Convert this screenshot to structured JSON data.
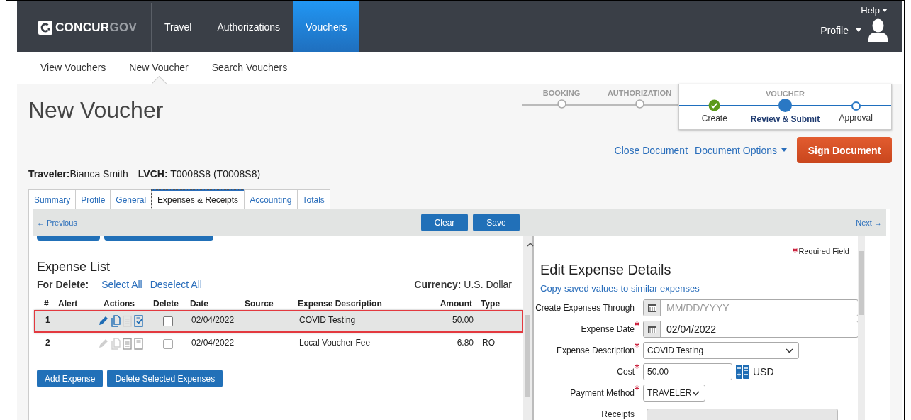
{
  "nav": {
    "logo": {
      "main": "CONCUR",
      "suffix": "GOV"
    },
    "tabs": [
      {
        "label": "Travel",
        "selected": false
      },
      {
        "label": "Authorizations",
        "selected": false
      },
      {
        "label": "Vouchers",
        "selected": true
      }
    ],
    "help": "Help",
    "profile": "Profile"
  },
  "subnav": [
    {
      "label": "View Vouchers",
      "selected": false
    },
    {
      "label": "New Voucher",
      "selected": true
    },
    {
      "label": "Search Vouchers",
      "selected": false
    }
  ],
  "page_title": "New Voucher",
  "progress": [
    {
      "label": "BOOKING",
      "selected": false
    },
    {
      "label": "AUTHORIZATION",
      "selected": false
    },
    {
      "label": "VOUCHER",
      "selected": true,
      "steps": [
        {
          "label": "Create",
          "completed": true,
          "selected": false
        },
        {
          "label": "Review & Submit",
          "completed": false,
          "selected": true
        },
        {
          "label": "Approval",
          "completed": false,
          "selected": false
        }
      ]
    }
  ],
  "document_actions": {
    "links": [
      {
        "label": "Close Document",
        "kind": "link"
      },
      {
        "label": "Document Options",
        "kind": "menu"
      }
    ],
    "primary": "Sign Document"
  },
  "traveler": "**Traveler:**Bianca Smith",
  "document_number": "**LVCH:** T0008S8 (T0008S8)",
  "tabs": [
    {
      "label": "Summary",
      "selected": false
    },
    {
      "label": "Profile",
      "selected": false
    },
    {
      "label": "General",
      "selected": false
    },
    {
      "label": "Expenses & Receipts",
      "selected": true
    },
    {
      "label": "Accounting",
      "selected": false
    },
    {
      "label": "Totals",
      "selected": false
    }
  ],
  "toolbar": {
    "previous": "← Previous",
    "buttons": [
      "Clear",
      "Save"
    ],
    "next": "Next →"
  },
  "expense_list": {
    "title": "Expense List",
    "for_delete": "For Delete:",
    "links": [
      "Select All",
      "Deselect All"
    ],
    "currency": "**Currency:** U.S. Dollar",
    "columns": [
      "#",
      "Alert",
      "Actions",
      "Delete",
      "Date",
      "Source",
      "Expense Description",
      "Amount",
      "Type"
    ],
    "rows": [
      {
        "number": "1",
        "selected": true,
        "actions_enabled": true,
        "checked": false,
        "date": "02/04/2022",
        "description": "COVID Testing",
        "amount": "50.00"
      },
      {
        "number": "2",
        "selected": false,
        "actions_enabled": false,
        "checked": false,
        "date": "02/04/2022",
        "description": "Local Voucher Fee",
        "amount": "6.80",
        "type": "RO"
      }
    ],
    "buttons": [
      "Add Expense",
      "Delete Selected Expenses"
    ]
  },
  "edit_expense": {
    "required_note": "Required Field",
    "title": "Edit Expense Details",
    "copy_link": "Copy saved values to similar expenses",
    "fields": [
      {
        "label": "Create Expenses Through",
        "required": false,
        "kind": "date",
        "placeholder": "MM/DD/YYYY"
      },
      {
        "label": "Expense Date",
        "required": true,
        "kind": "date",
        "value": "02/04/2022"
      },
      {
        "label": "Expense Description",
        "required": true,
        "kind": "select",
        "value": "COVID Testing"
      },
      {
        "label": "Cost",
        "required": true,
        "kind": "money",
        "value": "50.00",
        "currency": "USD"
      },
      {
        "label": "Payment Method",
        "required": true,
        "kind": "select",
        "value": "TRAVELER"
      },
      {
        "label": "Receipts",
        "required": false,
        "kind": "receipts"
      }
    ]
  }
}
